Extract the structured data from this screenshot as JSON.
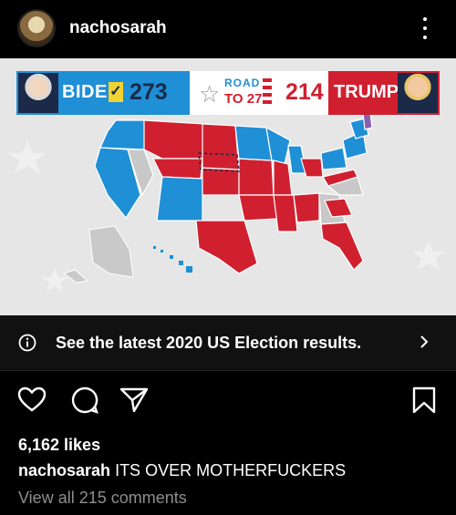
{
  "post": {
    "username": "nachosarah",
    "caption_user": "nachosarah",
    "caption_text": "ITS OVER MOTHERFUCKERS",
    "likes": "6,162 likes",
    "comments_link": "View all 215 comments"
  },
  "graphic": {
    "biden_name": "BIDEN",
    "biden_votes": "273",
    "road_top": "ROAD",
    "road_bottom": "TO 270",
    "trump_votes": "214",
    "trump_name": "TRUMP",
    "colors": {
      "blue": "#1f8fd6",
      "red": "#d02030",
      "gray": "#c8c8c8"
    }
  },
  "cta": {
    "text": "See the latest 2020 US Election results."
  },
  "icons": [
    "more-options-icon",
    "info-icon",
    "chevron-right-icon",
    "heart-icon",
    "comment-icon",
    "share-icon",
    "bookmark-icon"
  ]
}
